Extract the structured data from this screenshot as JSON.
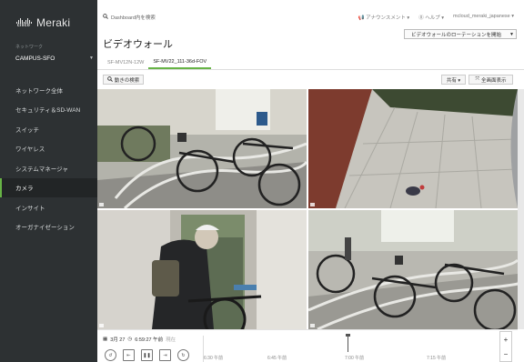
{
  "brand": {
    "product": "Meraki",
    "cisco": "cisco"
  },
  "sidebar": {
    "network_label": "ネットワーク",
    "network_value": "CAMPUS-SFO",
    "items": [
      {
        "label": "ネットワーク全体",
        "active": false
      },
      {
        "label": "セキュリティ＆SD-WAN",
        "active": false
      },
      {
        "label": "スイッチ",
        "active": false
      },
      {
        "label": "ワイヤレス",
        "active": false
      },
      {
        "label": "システムマネージャ",
        "active": false
      },
      {
        "label": "カメラ",
        "active": true
      },
      {
        "label": "インサイト",
        "active": false
      },
      {
        "label": "オーガナイゼーション",
        "active": false
      }
    ]
  },
  "header": {
    "search_placeholder": "Dashboard内を検索",
    "announcements": "アナウンスメント ▾",
    "help": "ヘルプ ▾",
    "user": "mcloud_meraki_japanese ▾"
  },
  "page": {
    "title": "ビデオウォール",
    "rotation_button": "ビデオウォールのローテーションを開始",
    "tabs": [
      "SF-MV12N-12W",
      "SF-MV22_111-36d-FOV"
    ],
    "active_tab": 1,
    "motion_search": "動きの検索",
    "share": "共有 ▾",
    "fullscreen": "全画面表示"
  },
  "playback": {
    "date": "3月 27",
    "time": "6:59:27 午前",
    "live": "現在",
    "timeline_labels": [
      "6:30 午前",
      "6:45 午前",
      "7:00 午前",
      "7:15 午前"
    ]
  },
  "icons": {
    "search": "search-icon",
    "calendar": "calendar-icon",
    "clock": "clock-icon",
    "rewind": "rewind-10-icon",
    "skip_back": "skip-back-icon",
    "pause": "pause-icon",
    "skip_forward": "skip-forward-icon",
    "forward": "forward-10-icon",
    "fullscreen": "fullscreen-icon"
  },
  "colors": {
    "sidebar": "#2d3133",
    "accent": "#67b346"
  }
}
